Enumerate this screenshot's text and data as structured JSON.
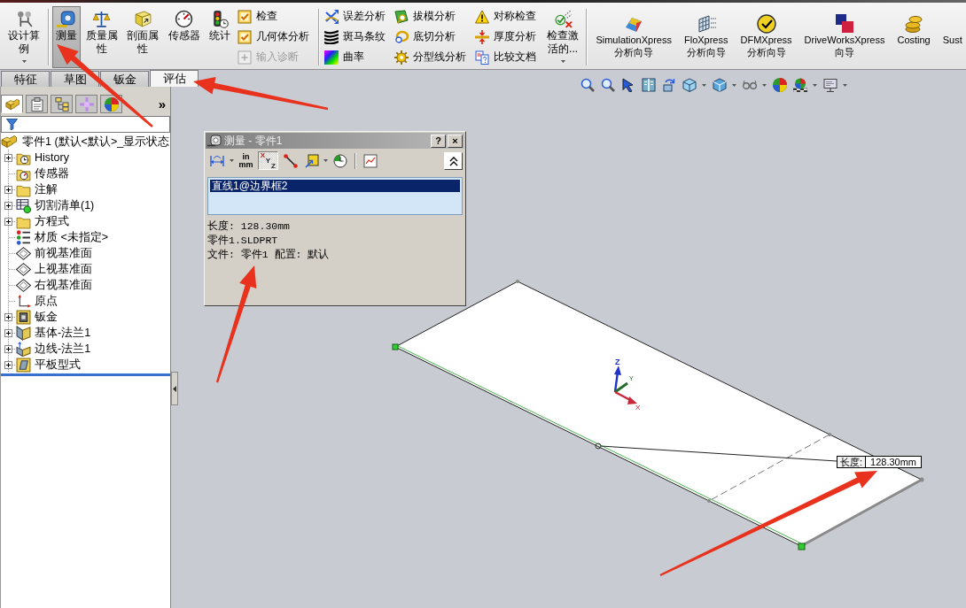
{
  "command_manager": {
    "groups": [
      [
        {
          "kind": "large",
          "label": "设计算例",
          "dropdown": true,
          "selected": false
        }
      ],
      [
        {
          "kind": "large",
          "label": "测量",
          "dropdown": false,
          "selected": true
        },
        {
          "kind": "large",
          "label": "质量属性",
          "dropdown": false,
          "selected": false
        },
        {
          "kind": "large",
          "label": "剖面属性",
          "dropdown": false,
          "selected": false
        },
        {
          "kind": "large",
          "label": "传感器",
          "dropdown": false,
          "selected": false
        },
        {
          "kind": "large",
          "label": "统计",
          "dropdown": false,
          "selected": false
        },
        {
          "kind": "stack",
          "entries": [
            {
              "label": "检查",
              "disabled": false
            },
            {
              "label": "几何体分析",
              "disabled": false
            },
            {
              "label": "输入诊断",
              "disabled": true
            }
          ]
        }
      ],
      [
        {
          "kind": "stack",
          "entries": [
            {
              "label": "误差分析",
              "disabled": false
            },
            {
              "label": "斑马条纹",
              "disabled": false
            },
            {
              "label": "曲率",
              "disabled": false
            }
          ]
        },
        {
          "kind": "stack",
          "entries": [
            {
              "label": "拔模分析",
              "disabled": false
            },
            {
              "label": "底切分析",
              "disabled": false
            },
            {
              "label": "分型线分析",
              "disabled": false
            }
          ]
        },
        {
          "kind": "stack",
          "entries": [
            {
              "label": "对称检查",
              "disabled": false
            },
            {
              "label": "厚度分析",
              "disabled": false
            },
            {
              "label": "比较文档",
              "disabled": false
            }
          ]
        },
        {
          "kind": "large",
          "label": "检查激活的...",
          "dropdown": true,
          "selected": false
        }
      ],
      [
        {
          "kind": "large",
          "label": "SimulationXpress 分析向导",
          "dropdown": false,
          "selected": false
        },
        {
          "kind": "large",
          "label": "FloXpress 分析向导",
          "dropdown": false,
          "selected": false
        },
        {
          "kind": "large",
          "label": "DFMXpress 分析向导",
          "dropdown": false,
          "selected": false
        },
        {
          "kind": "large",
          "label": "DriveWorksXpress 向导",
          "dropdown": false,
          "selected": false
        },
        {
          "kind": "large",
          "label": "Costing",
          "dropdown": false,
          "selected": false
        },
        {
          "kind": "large",
          "label": "Sust",
          "dropdown": false,
          "selected": false
        }
      ]
    ]
  },
  "tabs": [
    {
      "label": "特征",
      "selected": false
    },
    {
      "label": "草图",
      "selected": false
    },
    {
      "label": "钣金",
      "selected": false
    },
    {
      "label": "评估",
      "selected": true
    }
  ],
  "feature_manager": {
    "panel_tabs": [
      {
        "selected": true
      },
      {
        "selected": false
      },
      {
        "selected": false
      },
      {
        "selected": false
      },
      {
        "selected": false
      }
    ],
    "more": "»",
    "tree": {
      "label": "零件1 (默认<默认>_显示状态",
      "children": [
        {
          "label": "History",
          "expanded": false
        },
        {
          "label": "传感器"
        },
        {
          "label": "注解",
          "expanded": false
        },
        {
          "label": "切割清单(1)",
          "expanded": false
        },
        {
          "label": "方程式",
          "expanded": false
        },
        {
          "label": "材质 <未指定>"
        },
        {
          "label": "前视基准面"
        },
        {
          "label": "上视基准面"
        },
        {
          "label": "右视基准面"
        },
        {
          "label": "原点"
        },
        {
          "label": "钣金",
          "expanded": false
        },
        {
          "label": "基体-法兰1",
          "expanded": false
        },
        {
          "label": "边线-法兰1",
          "expanded": false
        },
        {
          "label": "平板型式",
          "expanded": false
        }
      ]
    }
  },
  "measure_dialog": {
    "title": "测量 - 零件1",
    "title_buttons": [
      "?",
      "×"
    ],
    "toolbar": [
      {
        "kind": "icon",
        "selected": false,
        "dropdown": true
      },
      {
        "kind": "units",
        "selected": false,
        "lines": [
          "in",
          "mm"
        ]
      },
      {
        "kind": "xyz",
        "selected": true,
        "letters": [
          "X",
          "Y",
          "Z"
        ]
      },
      {
        "kind": "icon",
        "selected": false,
        "dropdown": false
      },
      {
        "kind": "icon",
        "selected": false,
        "dropdown": true
      },
      {
        "kind": "icon",
        "selected": false,
        "dropdown": false
      },
      {
        "kind": "icon",
        "selected": false,
        "dropdown": false
      }
    ],
    "selections": [
      {
        "label": "直线1@边界框2",
        "selected": true
      }
    ],
    "results": [
      "长度: 128.30mm",
      "零件1.SLDPRT",
      "文件: 零件1 配置: 默认"
    ]
  },
  "viewport": {
    "triad_labels": [
      "Z",
      "Y",
      "X"
    ],
    "dimension_tooltip": {
      "label": "长度:",
      "value": "128.30mm"
    }
  }
}
